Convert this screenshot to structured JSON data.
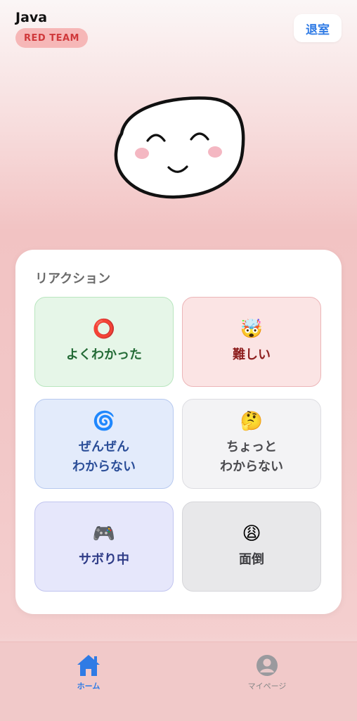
{
  "header": {
    "title": "Java",
    "team_badge": "RED TEAM",
    "exit_label": "退室"
  },
  "reactions": {
    "title": "リアクション",
    "items": [
      {
        "emoji": "⭕",
        "label": "よくわかった"
      },
      {
        "emoji": "🤯",
        "label": "難しい"
      },
      {
        "emoji": "🌀",
        "label": "ぜんぜん\nわからない"
      },
      {
        "emoji": "🤔",
        "label": "ちょっと\nわからない"
      },
      {
        "emoji": "🎮",
        "label": "サボり中"
      },
      {
        "emoji": "😩",
        "label": "面倒"
      }
    ]
  },
  "tabbar": {
    "home_label": "ホーム",
    "mypage_label": "マイページ"
  },
  "colors": {
    "accent": "#2f7be5",
    "team": "#d0393b"
  }
}
